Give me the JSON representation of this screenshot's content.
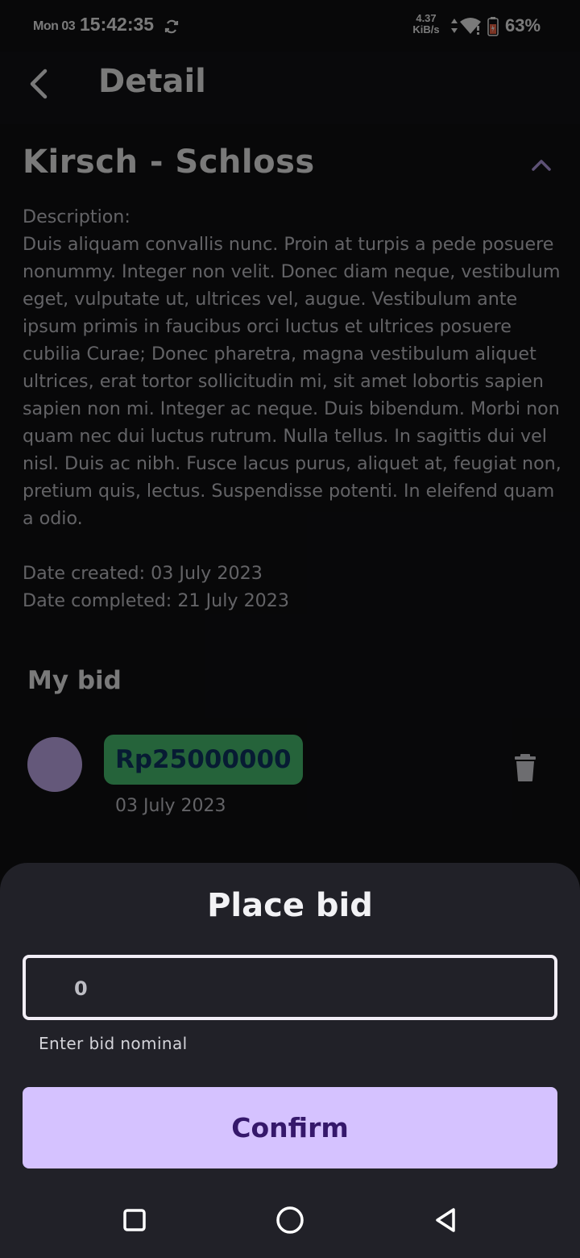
{
  "status_bar": {
    "date": "Mon 03",
    "time": "15:42:35",
    "net_speed_value": "4.37",
    "net_speed_unit": "KiB/s",
    "battery": "63%",
    "battery_color": "#ff6b4a"
  },
  "app_bar": {
    "title": "Detail",
    "back_icon": "chevron-left-icon"
  },
  "item": {
    "title": "Kirsch - Schloss",
    "collapse_icon": "chevron-up-icon",
    "description_label": "Description:",
    "description": "Duis aliquam convallis nunc. Proin at turpis a pede posuere nonummy. Integer non velit. Donec diam neque, vestibulum eget, vulputate ut, ultrices vel, augue. Vestibulum ante ipsum primis in faucibus orci luctus et ultrices posuere cubilia Curae; Donec pharetra, magna vestibulum aliquet ultrices, erat tortor sollicitudin mi, sit amet lobortis sapien sapien non mi. Integer ac neque. Duis bibendum. Morbi non quam nec dui luctus rutrum. Nulla tellus. In sagittis dui vel nisl. Duis ac nibh. Fusce lacus purus, aliquet at, feugiat non, pretium quis, lectus. Suspendisse potenti. In eleifend quam a odio.",
    "date_created": "Date created: 03 July 2023",
    "date_completed": "Date completed: 21 July 2023"
  },
  "my_bid": {
    "section_title": "My bid",
    "amount": "Rp25000000",
    "date": "03 July 2023",
    "amount_bg_color": "#4fd07a",
    "avatar_color": "#d2b8ff",
    "delete_icon": "trash-icon"
  },
  "place_bid_sheet": {
    "title": "Place bid",
    "input_value": "0",
    "helper_text": "Enter bid nominal",
    "confirm_label": "Confirm",
    "confirm_bg_color": "#d5c2ff"
  },
  "nav_bar": {
    "recent_icon": "square-icon",
    "home_icon": "circle-icon",
    "back_icon": "triangle-back-icon"
  }
}
